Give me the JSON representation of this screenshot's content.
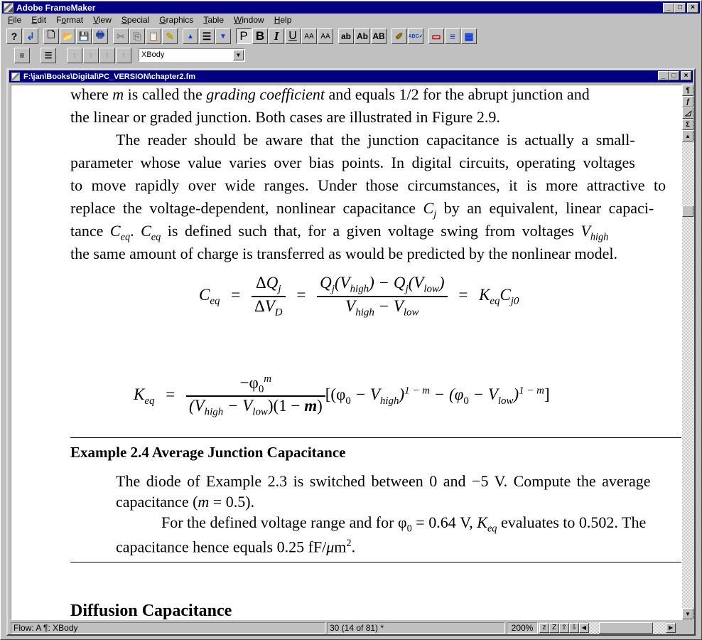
{
  "app": {
    "title": "Adobe FrameMaker",
    "window_controls": {
      "minimize": "_",
      "maximize": "□",
      "close": "×"
    }
  },
  "menu": [
    {
      "label": "File",
      "u": "F",
      "rest": "ile"
    },
    {
      "label": "Edit",
      "u": "E",
      "rest": "dit"
    },
    {
      "label": "Format",
      "pre": "F",
      "u": "o",
      "rest": "rmat"
    },
    {
      "label": "View",
      "u": "V",
      "rest": "iew"
    },
    {
      "label": "Special",
      "u": "S",
      "rest": "pecial"
    },
    {
      "label": "Graphics",
      "u": "G",
      "rest": "raphics"
    },
    {
      "label": "Table",
      "u": "T",
      "rest": "able"
    },
    {
      "label": "Window",
      "u": "W",
      "rest": "indow"
    },
    {
      "label": "Help",
      "u": "H",
      "rest": "elp"
    }
  ],
  "toolbar": {
    "buttons": [
      {
        "name": "help-button",
        "icon": "?"
      },
      {
        "name": "smart-spaces-button",
        "icon": "↲"
      },
      {
        "name": "new-button",
        "icon": "🗋"
      },
      {
        "name": "open-button",
        "icon": "📂"
      },
      {
        "name": "save-button",
        "icon": "💾"
      },
      {
        "name": "print-button",
        "icon": "🖶"
      },
      {
        "name": "cut-button",
        "icon": "✂"
      },
      {
        "name": "copy-button",
        "icon": "⎘"
      },
      {
        "name": "paste-button",
        "icon": "📋"
      },
      {
        "name": "clear-button",
        "icon": "✎"
      },
      {
        "name": "prev-button",
        "icon": "▲"
      },
      {
        "name": "paragraph-list-button",
        "icon": "☰"
      },
      {
        "name": "next-button",
        "icon": "▼"
      },
      {
        "name": "plain-button",
        "icon": "P"
      },
      {
        "name": "bold-button",
        "icon": "B"
      },
      {
        "name": "italic-button",
        "icon": "I"
      },
      {
        "name": "underline-button",
        "icon": "U"
      },
      {
        "name": "superscript-button",
        "icon": "AA"
      },
      {
        "name": "subscript-button",
        "icon": "AA"
      },
      {
        "name": "lowercase-button",
        "icon": "ab"
      },
      {
        "name": "titlecase-button",
        "icon": "Ab"
      },
      {
        "name": "uppercase-button",
        "icon": "AB"
      },
      {
        "name": "character-format-button",
        "icon": "✐"
      },
      {
        "name": "spelling-button",
        "icon": "ABC✓"
      },
      {
        "name": "anchored-frame-button",
        "icon": "▭"
      },
      {
        "name": "footnote-button",
        "icon": "≡"
      },
      {
        "name": "table-button",
        "icon": "▦"
      }
    ],
    "row2": {
      "paragraph_style": "XBody"
    }
  },
  "document": {
    "path": "F:\\jan\\Books\\Digital\\PC_VERSION\\chapter2.fm",
    "para1": {
      "l1_a": "where ",
      "l1_m": "m",
      "l1_b": " is called the ",
      "l1_c": "grading coefficient",
      "l1_d": " and equals 1/2 for the abrupt junction and",
      "l2": "the linear or graded junction. Both cases are illustrated in Figure 2.9."
    },
    "para2": {
      "l1": "The reader should be aware that the junction capacitance is actually a small-",
      "l2": "parameter whose value varies over bias points. In digital circuits, operating voltages",
      "l3": "to move rapidly over wide ranges. Under those circumstances, it is more attractive to",
      "l4_a": "replace the voltage-dependent, nonlinear capacitance ",
      "l4_c": "C",
      "l4_sub": "j",
      "l4_b": " by an equivalent, linear capaci-",
      "l5_a": "tance ",
      "l5_c": "C",
      "l5_sub": "eq",
      "l5_b": ". ",
      "l5_c2": "C",
      "l5_sub2": "eq",
      "l5_d": " is defined such that, for a given voltage swing from voltages ",
      "l5_v": "V",
      "l5_vsub": "high",
      "l6": "the same amount of charge is transferred as would be predicted by the nonlinear model."
    },
    "eq1": {
      "lhs": "C",
      "lhs_sub": "eq",
      "eq": "=",
      "f1_num": "ΔQ",
      "f1_num_sub": "j",
      "f1_den": "ΔV",
      "f1_den_sub": "D",
      "f2_num_a": "Q",
      "f2_num_a_sub": "j",
      "f2_num_b": "(V",
      "f2_num_b_sub": "high",
      "f2_num_c": ") − Q",
      "f2_num_c_sub": "j",
      "f2_num_d": "(V",
      "f2_num_d_sub": "low",
      "f2_num_e": ")",
      "f2_den_a": "V",
      "f2_den_a_sub": "high",
      "f2_den_b": " − V",
      "f2_den_b_sub": "low",
      "rhs_k": "K",
      "rhs_k_sub": "eq",
      "rhs_c": "C",
      "rhs_c_sub": "j0"
    },
    "eq2": {
      "lhs": "K",
      "lhs_sub": "eq",
      "eq": "=",
      "num": "−φ",
      "num_sub": "0",
      "num_sup": "m",
      "den_a": "(V",
      "den_a_sub": "high",
      "den_b": " − V",
      "den_b_sub": "low",
      "den_c": ")(1 − ",
      "den_m": "m",
      "den_d": ")",
      "br_a": "[(φ",
      "br_a_sub": "0",
      "br_b": " − V",
      "br_b_sub": "high",
      "br_c": ")",
      "br_c_sup": "1 − m",
      "br_d": " − (φ",
      "br_d_sub": "0",
      "br_e": " − V",
      "br_e_sub": "low",
      "br_f": ")",
      "br_f_sup": "1 − m",
      "br_g": "]"
    },
    "example": {
      "heading": "Example 2.4    Average Junction Capacitance",
      "l1": "The diode of Example 2.3 is switched between 0 and −5 V. Compute the average",
      "l2_a": "capacitance (",
      "l2_m": "m",
      "l2_b": " = 0.5).",
      "l3_a": "For the defined voltage range and for φ",
      "l3_sub": "0",
      "l3_b": " = 0.64 V, ",
      "l3_k": "K",
      "l3_ksub": "eq",
      "l3_c": " evaluates to 0.502. The",
      "l4_a": "capacitance hence equals 0.25 fF/",
      "l4_mu": "μ",
      "l4_b": "m",
      "l4_sup": "2",
      "l4_c": "."
    },
    "section_heading": "Diffusion Capacitance"
  },
  "side_palette": [
    "¶",
    "ƒ",
    "◿",
    "Σ",
    "▲"
  ],
  "status": {
    "flow": "Flow: A  ¶: XBody",
    "page": "30 (14 of 81) *",
    "zoom": "200%",
    "zoom_out": "z",
    "zoom_in": "Z",
    "prev_page": "⇧",
    "next_page": "⇩"
  }
}
